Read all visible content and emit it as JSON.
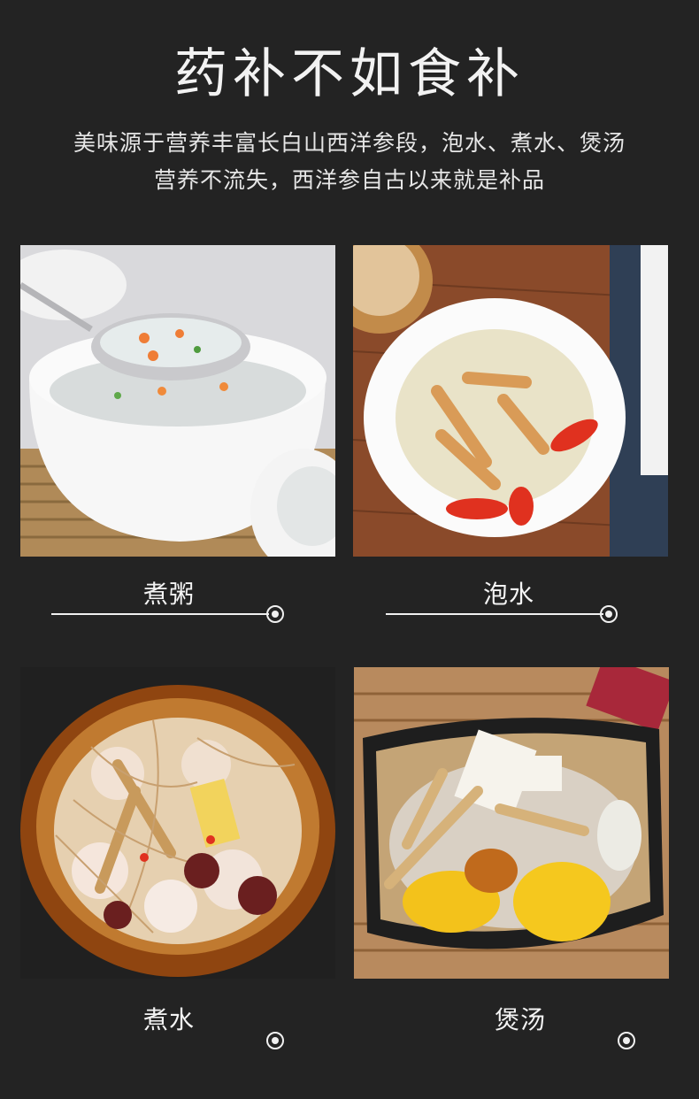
{
  "header": {
    "title": "药补不如食补",
    "subtitle_line1": "美味源于营养丰富长白山西洋参段，泡水、煮水、煲汤",
    "subtitle_line2": "营养不流失，西洋参自古以来就是补品"
  },
  "cards": [
    {
      "label": "煮粥",
      "image": "porridge-photo"
    },
    {
      "label": "泡水",
      "image": "ginseng-tea-photo"
    },
    {
      "label": "煮水",
      "image": "ginseng-pot-photo"
    },
    {
      "label": "煲汤",
      "image": "ginseng-soup-photo"
    }
  ],
  "colors": {
    "background": "#232323",
    "text": "#ffffff"
  }
}
